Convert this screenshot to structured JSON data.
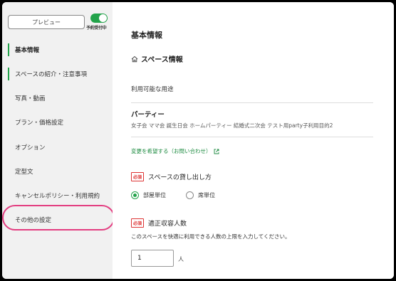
{
  "sidebar": {
    "preview_label": "プレビュー",
    "reservation_toggle_label": "予約受付中",
    "reservation_enabled": true,
    "items": [
      {
        "label": "基本情報",
        "active": true,
        "bold": true
      },
      {
        "label": "スペースの紹介・注意事項",
        "active": true,
        "bold": false
      },
      {
        "label": "写真・動画",
        "active": false,
        "bold": false
      },
      {
        "label": "プラン・価格設定",
        "active": false,
        "bold": false
      },
      {
        "label": "オプション",
        "active": false,
        "bold": false
      },
      {
        "label": "定型文",
        "active": false,
        "bold": false
      },
      {
        "label": "キャンセルポリシー・利用規約",
        "active": false,
        "bold": false
      },
      {
        "label": "その他の設定",
        "active": false,
        "bold": false
      }
    ]
  },
  "main": {
    "page_title": "基本情報",
    "section_title": "スペース情報",
    "usage_label": "利用可能な用途",
    "party_title": "パーティー",
    "party_tags": "女子会 ママ会 誕生日会 ホームパーティー 結婚式二次会 テスト用party子利用目的2",
    "change_link": "変更を希望する（お問い合わせ）",
    "rental": {
      "badge": "必須",
      "label": "スペースの貸し出し方",
      "options": [
        {
          "label": "部屋単位",
          "checked": true
        },
        {
          "label": "席単位",
          "checked": false
        }
      ]
    },
    "capacity": {
      "badge": "必須",
      "label": "適正収容人数",
      "description": "このスペースを快適に利用できる人数の上限を入力してください。",
      "value": "1",
      "unit": "人"
    }
  },
  "colors": {
    "accent": "#22a34a",
    "required": "#d33333",
    "highlight": "#e33d80"
  }
}
